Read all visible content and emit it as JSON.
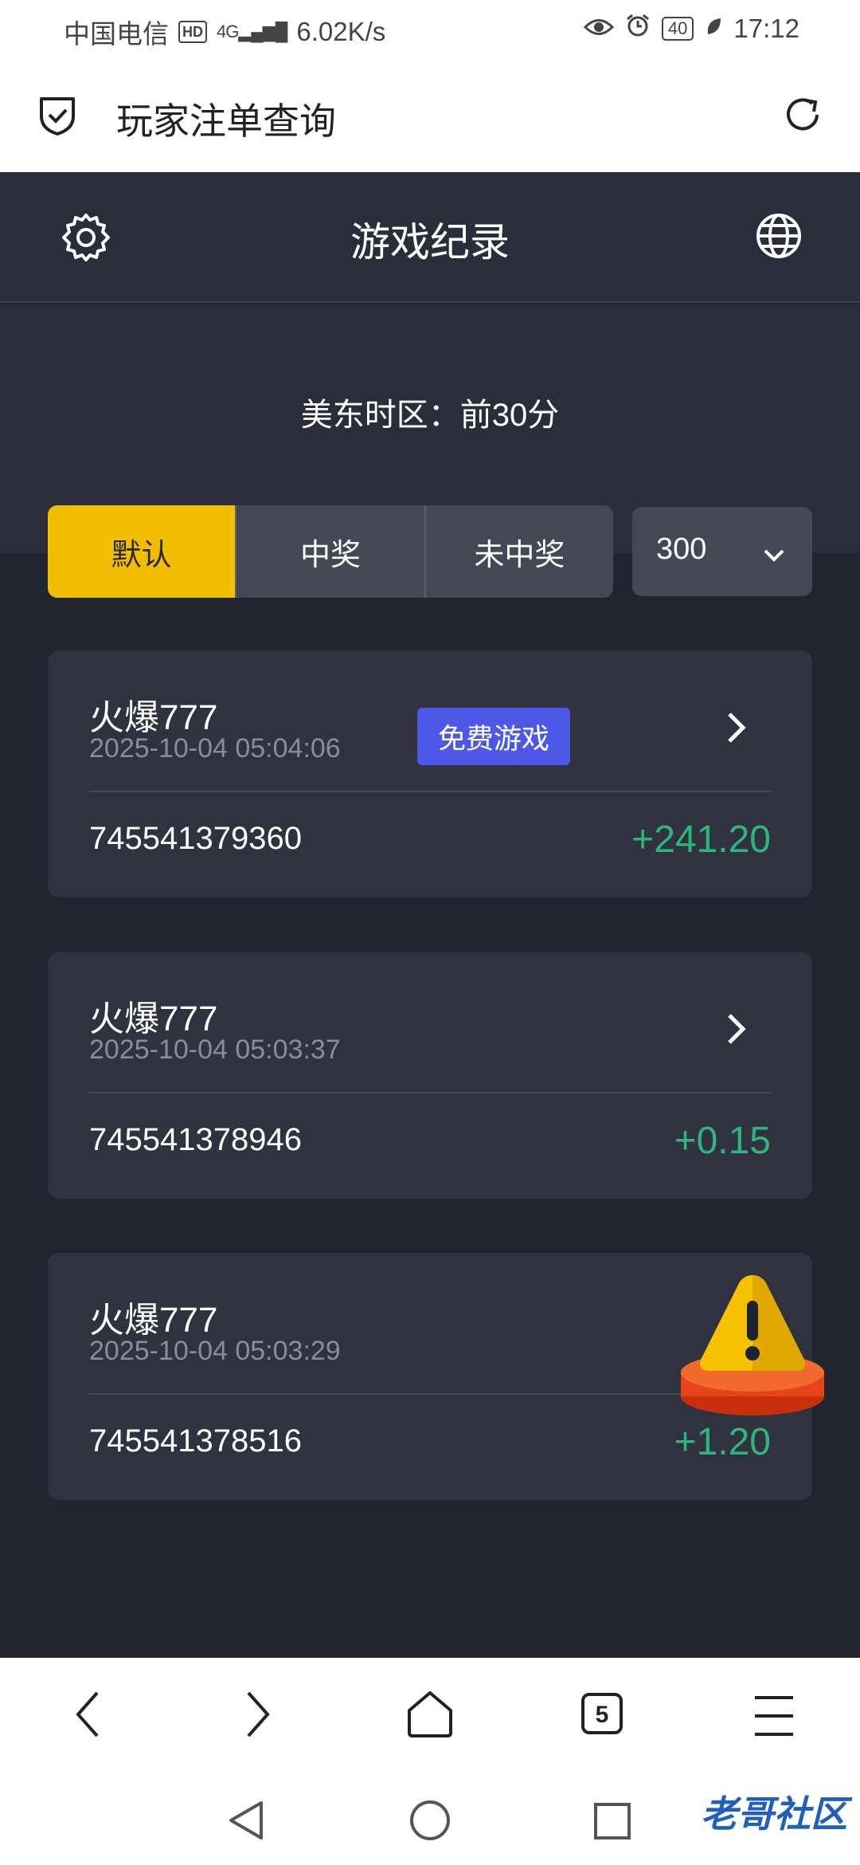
{
  "status_bar": {
    "carrier": "中国电信",
    "hd": "HD",
    "signal": "4G",
    "speed": "6.02K/s",
    "battery": "40",
    "time": "17:12"
  },
  "browser_header": {
    "title": "玩家注单查询"
  },
  "app_header": {
    "title": "游戏纪录"
  },
  "timezone_text": "美东时区：前30分",
  "filter_tabs": [
    {
      "label": "默认",
      "active": true
    },
    {
      "label": "中奖",
      "active": false
    },
    {
      "label": "未中奖",
      "active": false
    }
  ],
  "page_size_select": {
    "value": "300"
  },
  "records": [
    {
      "game": "火爆777",
      "time": "2025-10-04 05:04:06",
      "tag": "免费游戏",
      "id": "745541379360",
      "amount": "+241.20"
    },
    {
      "game": "火爆777",
      "time": "2025-10-04 05:03:37",
      "id": "745541378946",
      "amount": "+0.15"
    },
    {
      "game": "火爆777",
      "time": "2025-10-04 05:03:29",
      "id": "745541378516",
      "amount": "+1.20"
    }
  ],
  "browser_nav": {
    "tab_count": "5"
  },
  "watermark": "老哥社区",
  "colors": {
    "accent_active_tab": "#f3bd00",
    "win_amount": "#2db67c",
    "free_game_tag": "#4e58e6",
    "card_bg": "#30333f",
    "page_bg": "#222530"
  }
}
